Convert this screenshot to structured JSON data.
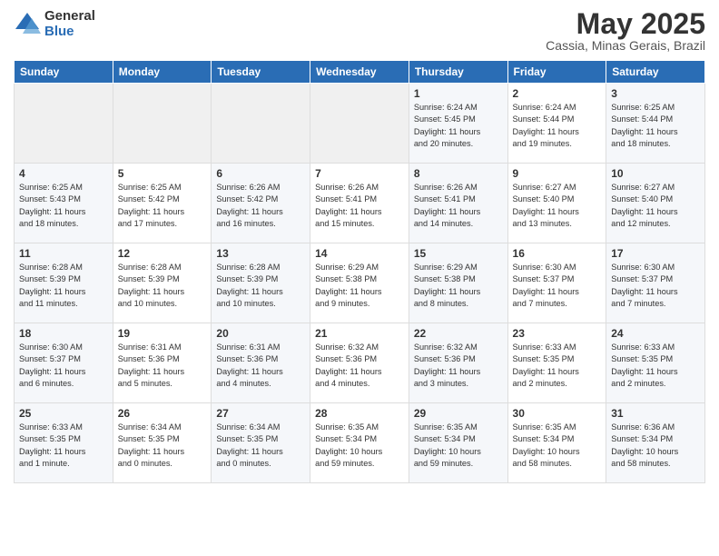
{
  "header": {
    "logo_general": "General",
    "logo_blue": "Blue",
    "month_title": "May 2025",
    "location": "Cassia, Minas Gerais, Brazil"
  },
  "days_of_week": [
    "Sunday",
    "Monday",
    "Tuesday",
    "Wednesday",
    "Thursday",
    "Friday",
    "Saturday"
  ],
  "weeks": [
    [
      {
        "day": "",
        "info": ""
      },
      {
        "day": "",
        "info": ""
      },
      {
        "day": "",
        "info": ""
      },
      {
        "day": "",
        "info": ""
      },
      {
        "day": "1",
        "info": "Sunrise: 6:24 AM\nSunset: 5:45 PM\nDaylight: 11 hours\nand 20 minutes."
      },
      {
        "day": "2",
        "info": "Sunrise: 6:24 AM\nSunset: 5:44 PM\nDaylight: 11 hours\nand 19 minutes."
      },
      {
        "day": "3",
        "info": "Sunrise: 6:25 AM\nSunset: 5:44 PM\nDaylight: 11 hours\nand 18 minutes."
      }
    ],
    [
      {
        "day": "4",
        "info": "Sunrise: 6:25 AM\nSunset: 5:43 PM\nDaylight: 11 hours\nand 18 minutes."
      },
      {
        "day": "5",
        "info": "Sunrise: 6:25 AM\nSunset: 5:42 PM\nDaylight: 11 hours\nand 17 minutes."
      },
      {
        "day": "6",
        "info": "Sunrise: 6:26 AM\nSunset: 5:42 PM\nDaylight: 11 hours\nand 16 minutes."
      },
      {
        "day": "7",
        "info": "Sunrise: 6:26 AM\nSunset: 5:41 PM\nDaylight: 11 hours\nand 15 minutes."
      },
      {
        "day": "8",
        "info": "Sunrise: 6:26 AM\nSunset: 5:41 PM\nDaylight: 11 hours\nand 14 minutes."
      },
      {
        "day": "9",
        "info": "Sunrise: 6:27 AM\nSunset: 5:40 PM\nDaylight: 11 hours\nand 13 minutes."
      },
      {
        "day": "10",
        "info": "Sunrise: 6:27 AM\nSunset: 5:40 PM\nDaylight: 11 hours\nand 12 minutes."
      }
    ],
    [
      {
        "day": "11",
        "info": "Sunrise: 6:28 AM\nSunset: 5:39 PM\nDaylight: 11 hours\nand 11 minutes."
      },
      {
        "day": "12",
        "info": "Sunrise: 6:28 AM\nSunset: 5:39 PM\nDaylight: 11 hours\nand 10 minutes."
      },
      {
        "day": "13",
        "info": "Sunrise: 6:28 AM\nSunset: 5:39 PM\nDaylight: 11 hours\nand 10 minutes."
      },
      {
        "day": "14",
        "info": "Sunrise: 6:29 AM\nSunset: 5:38 PM\nDaylight: 11 hours\nand 9 minutes."
      },
      {
        "day": "15",
        "info": "Sunrise: 6:29 AM\nSunset: 5:38 PM\nDaylight: 11 hours\nand 8 minutes."
      },
      {
        "day": "16",
        "info": "Sunrise: 6:30 AM\nSunset: 5:37 PM\nDaylight: 11 hours\nand 7 minutes."
      },
      {
        "day": "17",
        "info": "Sunrise: 6:30 AM\nSunset: 5:37 PM\nDaylight: 11 hours\nand 7 minutes."
      }
    ],
    [
      {
        "day": "18",
        "info": "Sunrise: 6:30 AM\nSunset: 5:37 PM\nDaylight: 11 hours\nand 6 minutes."
      },
      {
        "day": "19",
        "info": "Sunrise: 6:31 AM\nSunset: 5:36 PM\nDaylight: 11 hours\nand 5 minutes."
      },
      {
        "day": "20",
        "info": "Sunrise: 6:31 AM\nSunset: 5:36 PM\nDaylight: 11 hours\nand 4 minutes."
      },
      {
        "day": "21",
        "info": "Sunrise: 6:32 AM\nSunset: 5:36 PM\nDaylight: 11 hours\nand 4 minutes."
      },
      {
        "day": "22",
        "info": "Sunrise: 6:32 AM\nSunset: 5:36 PM\nDaylight: 11 hours\nand 3 minutes."
      },
      {
        "day": "23",
        "info": "Sunrise: 6:33 AM\nSunset: 5:35 PM\nDaylight: 11 hours\nand 2 minutes."
      },
      {
        "day": "24",
        "info": "Sunrise: 6:33 AM\nSunset: 5:35 PM\nDaylight: 11 hours\nand 2 minutes."
      }
    ],
    [
      {
        "day": "25",
        "info": "Sunrise: 6:33 AM\nSunset: 5:35 PM\nDaylight: 11 hours\nand 1 minute."
      },
      {
        "day": "26",
        "info": "Sunrise: 6:34 AM\nSunset: 5:35 PM\nDaylight: 11 hours\nand 0 minutes."
      },
      {
        "day": "27",
        "info": "Sunrise: 6:34 AM\nSunset: 5:35 PM\nDaylight: 11 hours\nand 0 minutes."
      },
      {
        "day": "28",
        "info": "Sunrise: 6:35 AM\nSunset: 5:34 PM\nDaylight: 10 hours\nand 59 minutes."
      },
      {
        "day": "29",
        "info": "Sunrise: 6:35 AM\nSunset: 5:34 PM\nDaylight: 10 hours\nand 59 minutes."
      },
      {
        "day": "30",
        "info": "Sunrise: 6:35 AM\nSunset: 5:34 PM\nDaylight: 10 hours\nand 58 minutes."
      },
      {
        "day": "31",
        "info": "Sunrise: 6:36 AM\nSunset: 5:34 PM\nDaylight: 10 hours\nand 58 minutes."
      }
    ]
  ]
}
